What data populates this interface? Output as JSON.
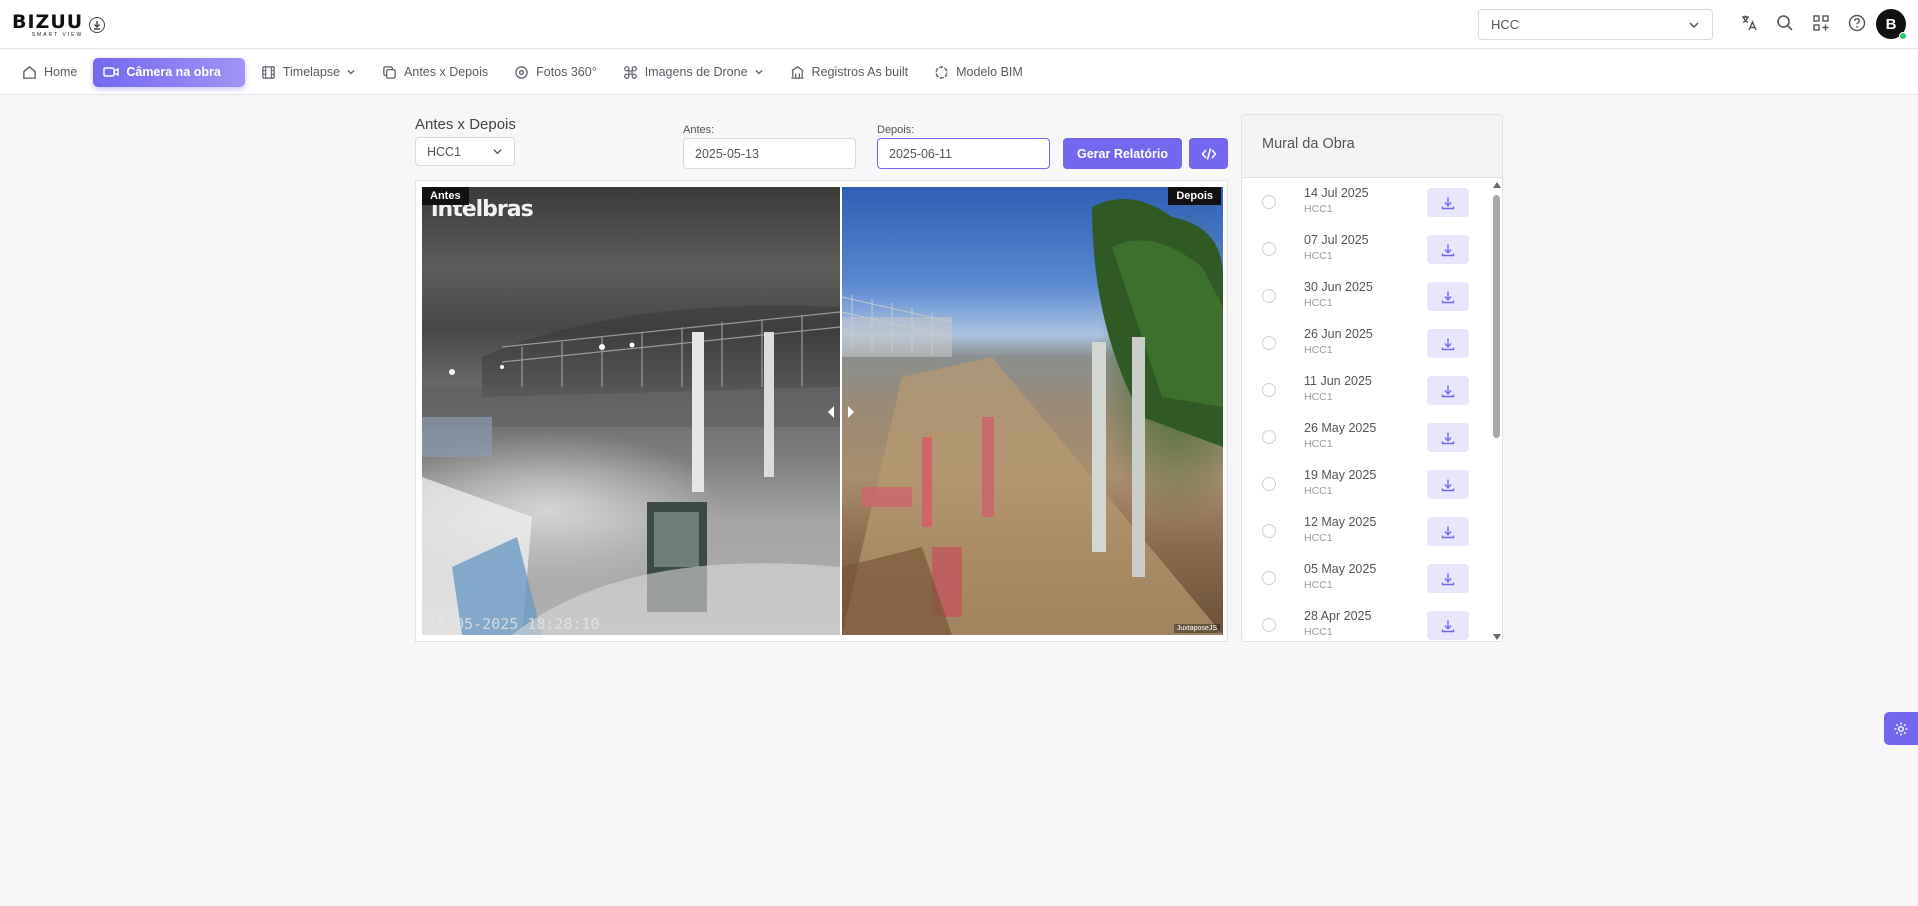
{
  "header": {
    "logo_text": "BIZUU",
    "logo_sub": "SMART VIEW",
    "project_select": "HCC",
    "avatar_initial": "B"
  },
  "nav": {
    "items": [
      {
        "label": "Home",
        "icon": "home-icon"
      },
      {
        "label": "Câmera na obra",
        "icon": "video-icon",
        "active": true
      },
      {
        "label": "Timelapse",
        "icon": "film-icon",
        "dropdown": true
      },
      {
        "label": "Antes x Depois",
        "icon": "copy-icon"
      },
      {
        "label": "Fotos 360°",
        "icon": "rotate-360-icon"
      },
      {
        "label": "Imagens de Drone",
        "icon": "drone-icon",
        "dropdown": true
      },
      {
        "label": "Registros As built",
        "icon": "building-icon"
      },
      {
        "label": "Modelo BIM",
        "icon": "cube-icon"
      }
    ]
  },
  "compare": {
    "title": "Antes x Depois",
    "camera_select": "HCC1",
    "before_label": "Antes:",
    "before_value": "2025-05-13",
    "after_label": "Depois:",
    "after_value": "2025-06-11",
    "report_button": "Gerar Relatório",
    "before_tag": "Antes",
    "after_tag": "Depois",
    "watermark": "intelbras",
    "timestamp": "13-05-2025 18:28:10",
    "credit": "JuxtaposeJS"
  },
  "mural": {
    "title": "Mural da Obra",
    "items": [
      {
        "date": "14 Jul 2025",
        "camera": "HCC1"
      },
      {
        "date": "07 Jul 2025",
        "camera": "HCC1"
      },
      {
        "date": "30 Jun 2025",
        "camera": "HCC1"
      },
      {
        "date": "26 Jun 2025",
        "camera": "HCC1"
      },
      {
        "date": "11 Jun 2025",
        "camera": "HCC1"
      },
      {
        "date": "26 May 2025",
        "camera": "HCC1"
      },
      {
        "date": "19 May 2025",
        "camera": "HCC1"
      },
      {
        "date": "12 May 2025",
        "camera": "HCC1"
      },
      {
        "date": "05 May 2025",
        "camera": "HCC1"
      },
      {
        "date": "28 Apr 2025",
        "camera": "HCC1"
      }
    ]
  },
  "colors": {
    "accent": "#7367f0",
    "accent_light": "#e8e6fd",
    "online": "#28c76f"
  }
}
